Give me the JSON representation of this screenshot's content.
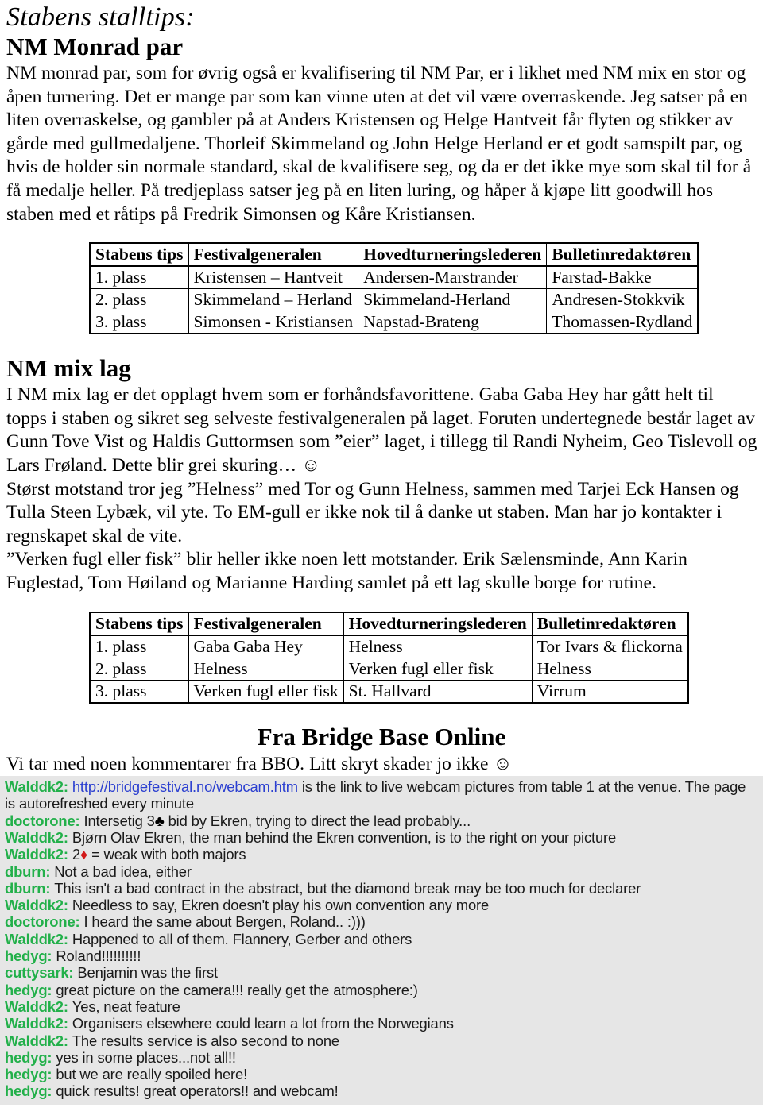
{
  "document": {
    "kicker": "Stabens stalltips:",
    "section1_heading": "NM Monrad par",
    "section1_paragraph": "NM monrad par, som for øvrig også er kvalifisering til NM Par, er i likhet med NM mix en stor og åpen turnering. Det er mange par som kan vinne uten at det vil være overraskende. Jeg satser på en liten overraskelse, og gambler på at Anders Kristensen og Helge Hantveit får flyten og stikker av gårde med gullmedaljene. Thorleif Skimmeland og John Helge Herland er et godt samspilt par, og hvis de holder sin normale standard, skal de kvalifisere seg, og da er det ikke mye som skal til for å få medalje heller. På tredjeplass satser jeg på en liten luring, og håper å kjøpe litt goodwill hos staben med et råtips på Fredrik Simonsen og Kåre Kristiansen.",
    "section2_heading": "NM mix lag",
    "section2_paragraph1": "I NM mix lag er det opplagt hvem som er forhåndsfavorittene. Gaba Gaba Hey har gått helt til topps i staben og sikret seg selveste festivalgeneralen på laget. Foruten undertegnede består laget av Gunn Tove Vist og Haldis Guttormsen som ”eier” laget, i tillegg til Randi Nyheim, Geo Tislevoll og Lars Frøland. Dette blir grei skuring… ☺",
    "section2_paragraph2": "Størst motstand tror jeg ”Helness” med Tor og Gunn Helness, sammen med Tarjei Eck Hansen og Tulla Steen Lybæk, vil yte. To EM-gull er ikke nok til å danke ut staben. Man har jo kontakter i regnskapet skal de vite.",
    "section2_paragraph3": "”Verken fugl eller fisk” blir heller ikke noen lett motstander. Erik Sælensminde, Ann Karin Fuglestad, Tom Høiland og Marianne Harding samlet på ett lag skulle borge for rutine.",
    "section3_heading": "Fra Bridge Base Online",
    "section3_intro": "Vi tar med noen kommentarer fra BBO. Litt skryt skader jo ikke ☺"
  },
  "table1": {
    "headers": [
      "Stabens tips",
      "Festivalgeneralen",
      "Hovedturneringslederen",
      "Bulletinredaktøren"
    ],
    "rows": [
      [
        "1. plass",
        "Kristensen – Hantveit",
        "Andersen-Marstrander",
        "Farstad-Bakke"
      ],
      [
        "2. plass",
        "Skimmeland – Herland",
        "Skimmeland-Herland",
        "Andresen-Stokkvik"
      ],
      [
        "3. plass",
        "Simonsen - Kristiansen",
        "Napstad-Brateng",
        "Thomassen-Rydland"
      ]
    ]
  },
  "table2": {
    "headers": [
      "Stabens tips",
      "Festivalgeneralen",
      "Hovedturneringslederen",
      "Bulletinredaktøren"
    ],
    "rows": [
      [
        "1. plass",
        "Gaba Gaba Hey",
        "Helness",
        "Tor Ivars & flickorna"
      ],
      [
        "2. plass",
        "Helness",
        "Verken fugl eller fisk",
        "Helness"
      ],
      [
        "3. plass",
        "Verken fugl eller fisk",
        "St. Hallvard",
        "Virrum"
      ]
    ]
  },
  "chat": {
    "lines": [
      {
        "user": "Walddk2:",
        "link": "http://bridgefestival.no/webcam.htm",
        "text": "  is the link to live webcam pictures from table 1 at the venue. The page is autorefreshed every minute"
      },
      {
        "user": "doctorone:",
        "pre": "Intersetig 3",
        "suit": "♣",
        "suit_color": "black",
        "text": " bid by Ekren, trying to direct the lead probably..."
      },
      {
        "user": "Walddk2:",
        "text": "Bjørn Olav Ekren, the man behind the Ekren convention, is to the right on your picture"
      },
      {
        "user": "Walddk2:",
        "pre": "2",
        "suit": "♦",
        "suit_color": "red",
        "text": " = weak with both majors"
      },
      {
        "user": "dburn:",
        "text": "Not a bad idea, either"
      },
      {
        "user": "dburn:",
        "text": "This isn't a bad contract in the abstract, but the diamond break may be too much for declarer"
      },
      {
        "user": "Walddk2:",
        "text": "Needless to say, Ekren doesn't play his own convention any more"
      },
      {
        "user": "doctorone:",
        "text": "I heard the same about Bergen, Roland.. :)))"
      },
      {
        "user": "Walddk2:",
        "text": "Happened to all of them. Flannery, Gerber and others"
      },
      {
        "user": "hedyg:",
        "text": "Roland!!!!!!!!!!"
      },
      {
        "user": "cuttysark:",
        "text": "Benjamin was the first"
      },
      {
        "user": "hedyg:",
        "text": "great picture on the camera!!! really get the atmosphere:)"
      },
      {
        "user": "Walddk2:",
        "text": "Yes, neat feature"
      },
      {
        "user": "Walddk2:",
        "text": "Organisers elsewhere could learn a lot from the Norwegians"
      },
      {
        "user": "Walddk2:",
        "text": "The results service is also second to none"
      },
      {
        "user": "hedyg:",
        "text": "yes in some places...not all!!"
      },
      {
        "user": "hedyg:",
        "text": "but we are really spoiled here!"
      },
      {
        "user": "hedyg:",
        "text": "quick results! great operators!! and webcam!"
      }
    ]
  },
  "colors": {
    "chat_background": "#e6e6e6",
    "chat_username": "#22b04a",
    "chat_link": "#2b3fd0",
    "suit_red": "#d21a1a",
    "suit_black": "#000000"
  }
}
